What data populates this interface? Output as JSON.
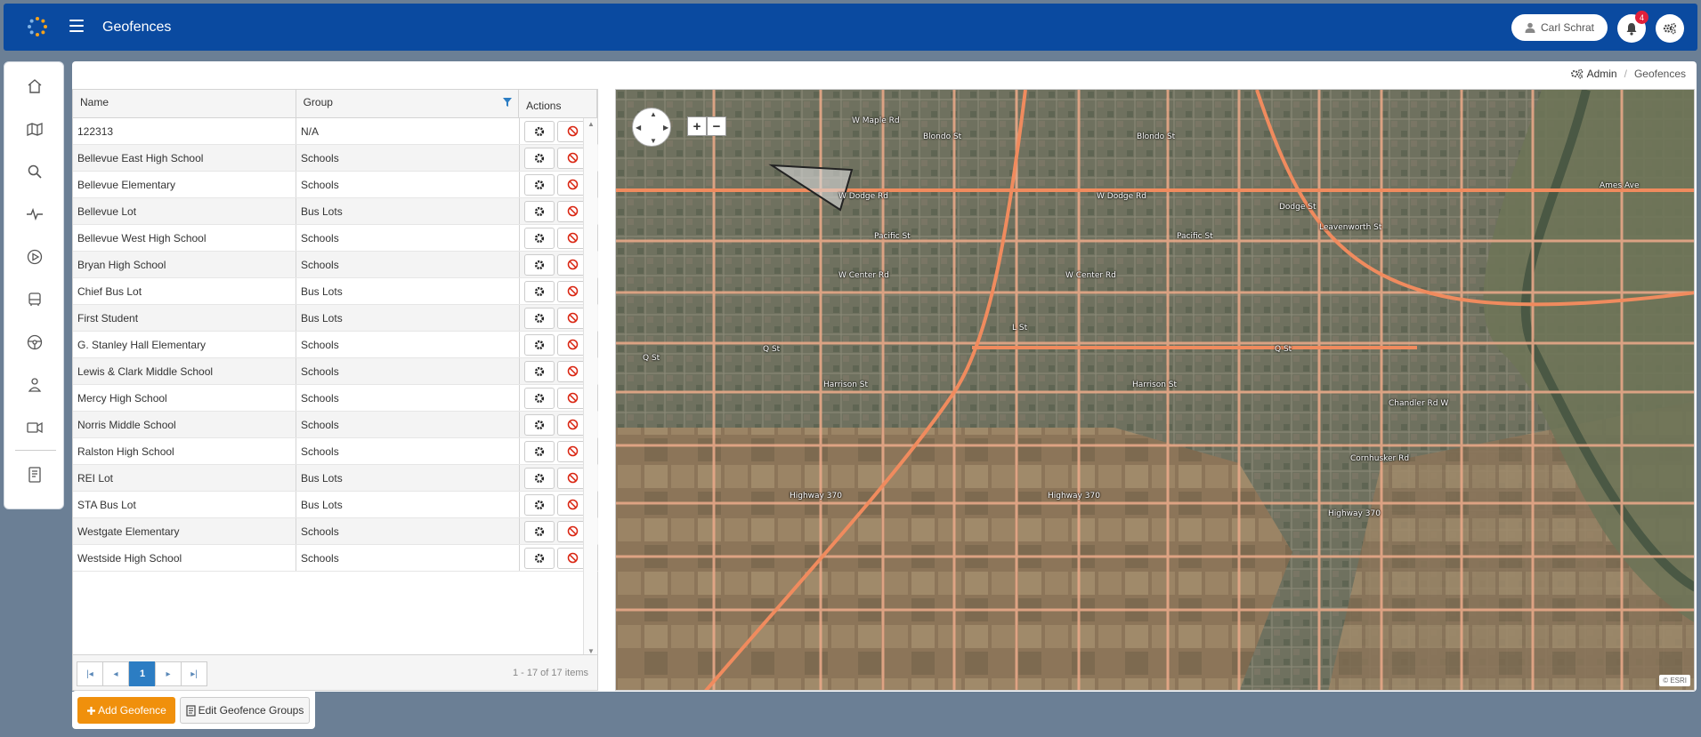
{
  "header": {
    "title": "Geofences",
    "user_name": "Carl Schrat",
    "notification_count": "4"
  },
  "breadcrumb": {
    "admin": "Admin",
    "current": "Geofences"
  },
  "grid": {
    "columns": {
      "name": "Name",
      "group": "Group",
      "actions": "Actions"
    },
    "rows": [
      {
        "name": "122313",
        "group": "N/A"
      },
      {
        "name": "Bellevue East High School",
        "group": "Schools"
      },
      {
        "name": "Bellevue Elementary",
        "group": "Schools"
      },
      {
        "name": "Bellevue Lot",
        "group": "Bus Lots"
      },
      {
        "name": "Bellevue West High School",
        "group": "Schools"
      },
      {
        "name": "Bryan High School",
        "group": "Schools"
      },
      {
        "name": "Chief Bus Lot",
        "group": "Bus Lots"
      },
      {
        "name": "First Student",
        "group": "Bus Lots"
      },
      {
        "name": "G. Stanley Hall Elementary",
        "group": "Schools"
      },
      {
        "name": "Lewis & Clark Middle School",
        "group": "Schools"
      },
      {
        "name": "Mercy High School",
        "group": "Schools"
      },
      {
        "name": "Norris Middle School",
        "group": "Schools"
      },
      {
        "name": "Ralston High School",
        "group": "Schools"
      },
      {
        "name": "REI Lot",
        "group": "Bus Lots"
      },
      {
        "name": "STA Bus Lot",
        "group": "Bus Lots"
      },
      {
        "name": "Westgate Elementary",
        "group": "Schools"
      },
      {
        "name": "Westside High School",
        "group": "Schools"
      }
    ]
  },
  "pager": {
    "current_page": "1",
    "info": "1 - 17 of 17 items"
  },
  "map": {
    "zoom_in": "+",
    "zoom_out": "−",
    "attribution": "© ESRI",
    "labels": {
      "w_dodge": "W Dodge Rd",
      "w_center": "W Center Rd",
      "w_maple": "W Maple Rd",
      "pacific": "Pacific St",
      "harrison": "Harrison St",
      "highway370": "Highway 370",
      "q_st": "Q St",
      "l_st": "L St",
      "dodge": "Dodge St",
      "leavenworth": "Leavenworth St",
      "cornhusker": "Cornhusker Rd",
      "chandler": "Chandler Rd W",
      "blondo": "Blondo St",
      "ames": "Ames Ave"
    }
  },
  "buttons": {
    "add_geofence": "Add Geofence",
    "edit_groups": "Edit Geofence Groups"
  },
  "colors": {
    "header_bg": "#0a4aa0",
    "accent_orange": "#f0900c",
    "delete_red": "#d9230f",
    "page_active": "#2c7dc3"
  }
}
